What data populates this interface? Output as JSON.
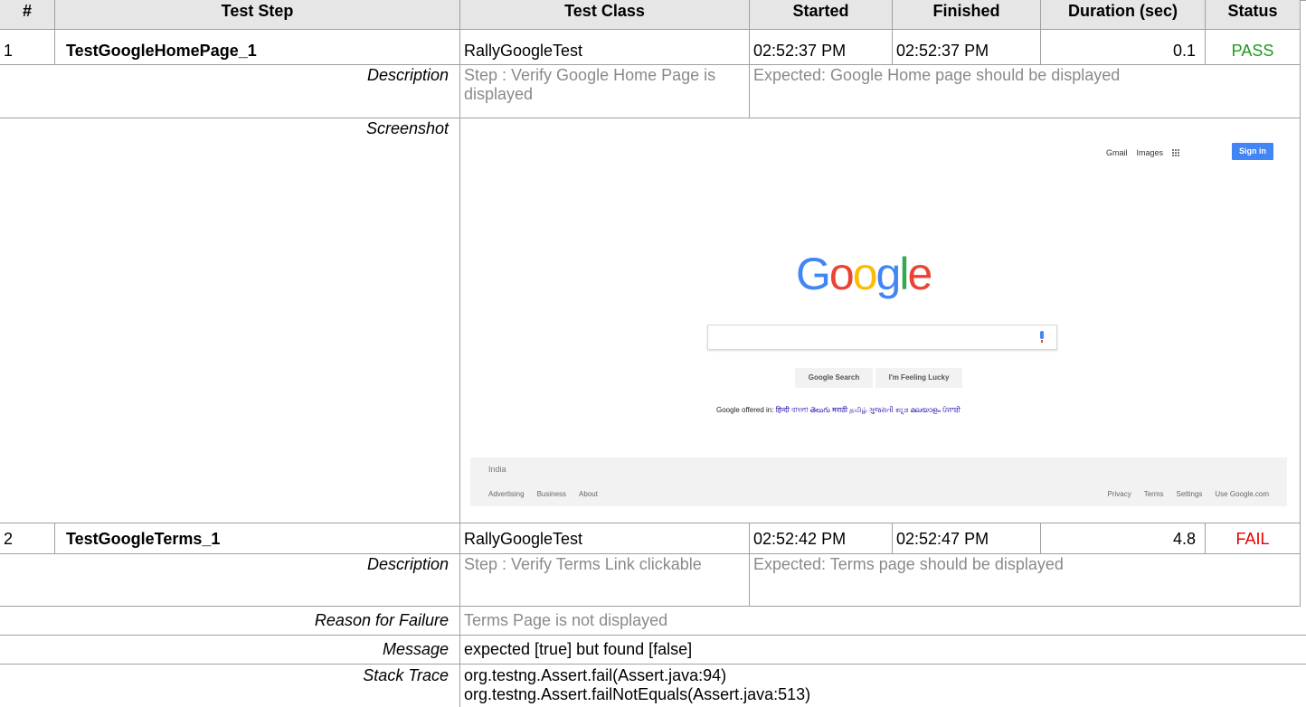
{
  "headers": [
    "#",
    "Test Step",
    "Test Class",
    "Started",
    "Finished",
    "Duration (sec)",
    "Status"
  ],
  "tests": [
    {
      "num": "1",
      "step": "TestGoogleHomePage_1",
      "class": "RallyGoogleTest",
      "started": "02:52:37 PM",
      "finished": "02:52:37 PM",
      "duration": "0.1",
      "status": "PASS",
      "description_label": "Description",
      "description_step": "Step : Verify Google Home Page is displayed",
      "description_expected": "Expected: Google Home page should be displayed",
      "screenshot_label": "Screenshot"
    },
    {
      "num": "2",
      "step": "TestGoogleTerms_1",
      "class": "RallyGoogleTest",
      "started": "02:52:42 PM",
      "finished": "02:52:47 PM",
      "duration": "4.8",
      "status": "FAIL",
      "description_label": "Description",
      "description_step": "Step : Verify Terms Link clickable",
      "description_expected": "Expected: Terms page should be displayed",
      "reason_label": "Reason for Failure",
      "reason": "Terms Page is not displayed",
      "message_label": "Message",
      "message": "expected [true] but found [false]",
      "stack_label": "Stack Trace",
      "stack_lines": [
        "org.testng.Assert.fail(Assert.java:94)",
        "org.testng.Assert.failNotEquals(Assert.java:513)"
      ]
    }
  ],
  "screenshot": {
    "gmail": "Gmail",
    "images": "Images",
    "signin": "Sign in",
    "logo_letters": [
      "G",
      "o",
      "o",
      "g",
      "l",
      "e"
    ],
    "search_button": "Google Search",
    "lucky_button": "I'm Feeling Lucky",
    "offered_prefix": "Google offered in:",
    "languages": "हिन्दी বাংলা తెలుగు मराठी தமிழ் ગુજરાતી ಕನ್ನಡ മലയാളം ਪੰਜਾਬੀ",
    "country": "India",
    "footer_left": [
      "Advertising",
      "Business",
      "About"
    ],
    "footer_right": [
      "Privacy",
      "Terms",
      "Settings",
      "Use Google.com"
    ]
  },
  "colors": {
    "pass": "#1e9a1e",
    "fail": "#e60000",
    "header_bg": "#e6e6e6",
    "logo": [
      "#4285f4",
      "#ea4335",
      "#fbbc05",
      "#4285f4",
      "#34a853",
      "#ea4335"
    ]
  }
}
